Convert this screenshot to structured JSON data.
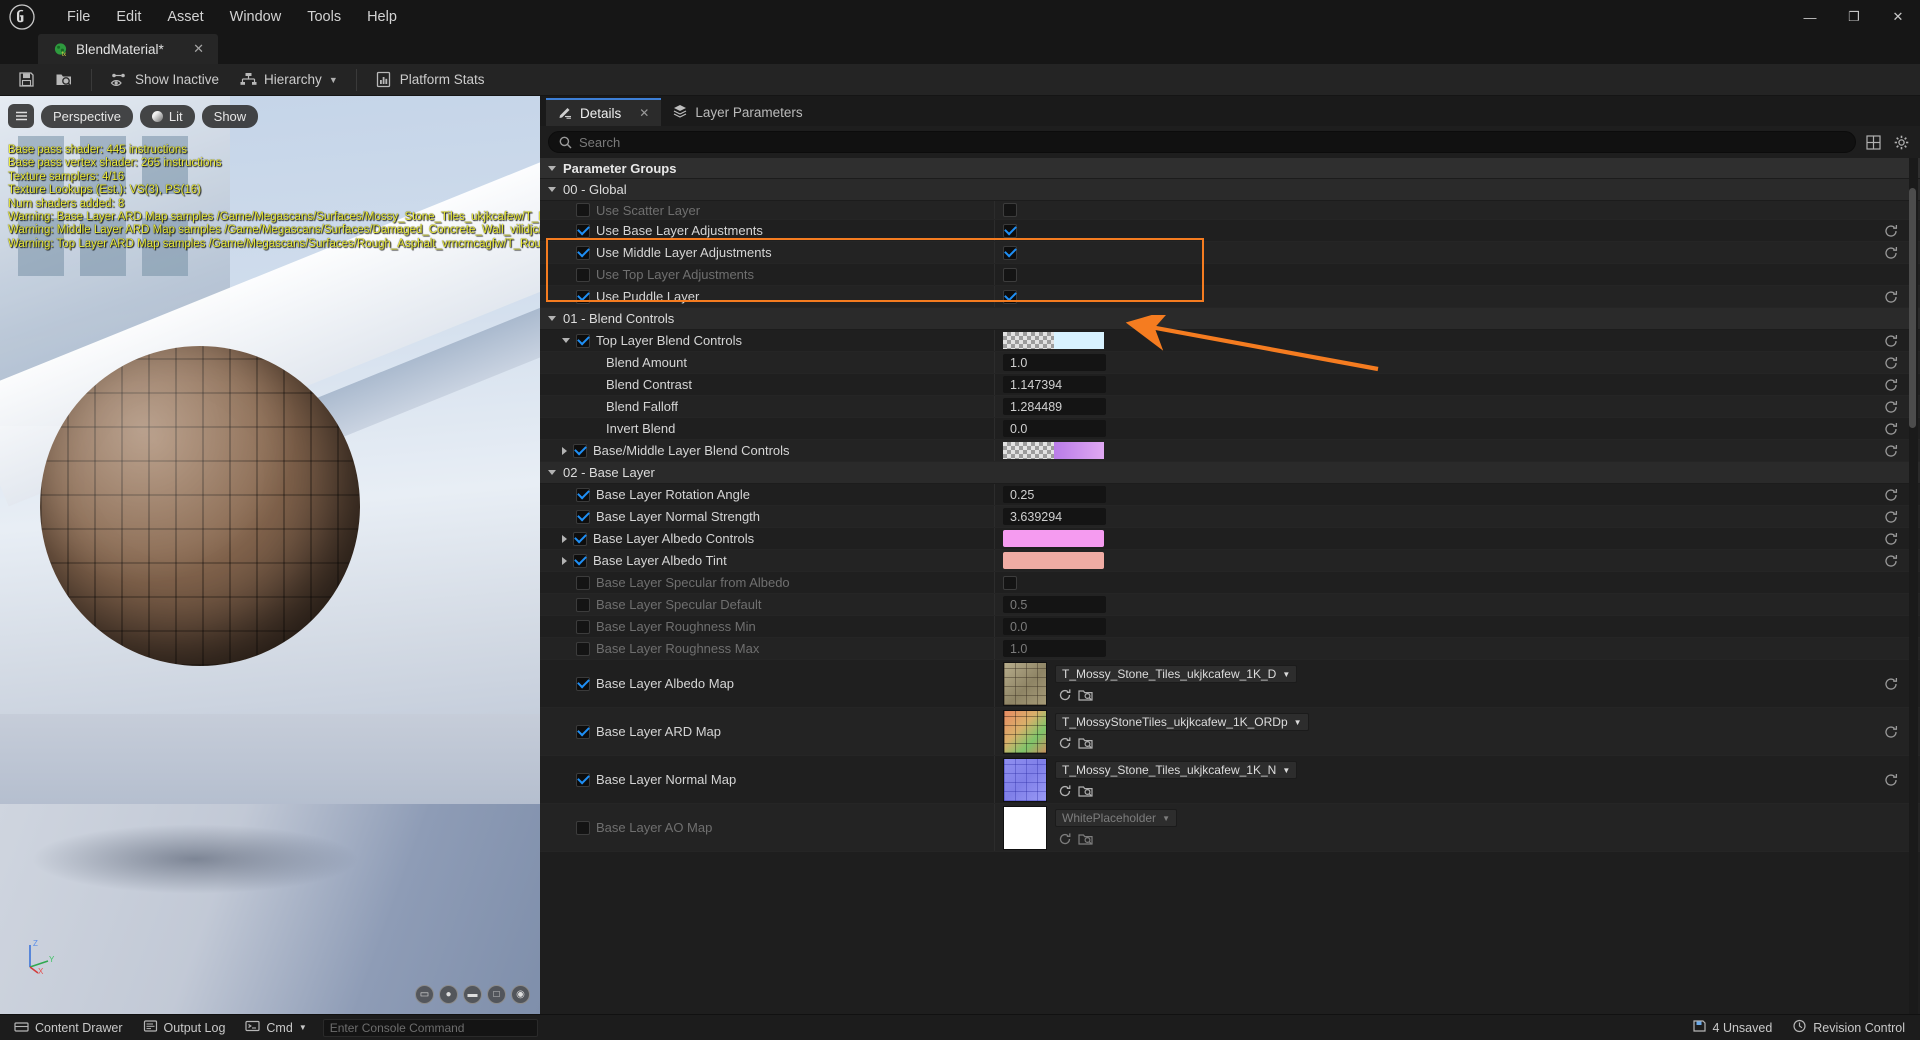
{
  "window": {
    "menus": [
      "File",
      "Edit",
      "Asset",
      "Window",
      "Tools",
      "Help"
    ],
    "controls": {
      "minimize": "—",
      "maximize": "❐",
      "close": "✕"
    }
  },
  "document_tab": {
    "label": "BlendMaterial*",
    "close": "✕",
    "icon": "material-instance-icon"
  },
  "toolbar": {
    "save_icon": "save-icon",
    "browse_icon": "browse-to-asset-icon",
    "show_inactive": "Show Inactive",
    "hierarchy": "Hierarchy",
    "platform_stats": "Platform Stats"
  },
  "viewport": {
    "menu_icon": "viewport-menu-icon",
    "perspective": "Perspective",
    "lit": "Lit",
    "show": "Show",
    "stats": [
      "Base pass shader: 445 instructions",
      "Base pass vertex shader: 265 instructions",
      "Texture samplers: 4/16",
      "Texture Lookups (Est.): VS(3), PS(16)",
      "Num shaders added: 8",
      "Warning: Base Layer ARD Map samples /Game/Megascans/Surfaces/Mossy_Stone_Tiles_ukjkcafew/T_M",
      "Warning: Middle Layer ARD Map samples /Game/Megascans/Surfaces/Damaged_Concrete_Wall_vilidjc/T_",
      "Warning: Top Layer ARD Map samples /Game/Megascans/Surfaces/Rough_Asphalt_vrncmcagfw/T_Roug"
    ],
    "axis": {
      "z": "Z",
      "y": "Y",
      "x": "X"
    }
  },
  "panel_tabs": [
    {
      "label": "Details",
      "icon": "details-pencil-icon",
      "active": true,
      "close": "✕"
    },
    {
      "label": "Layer Parameters",
      "icon": "layers-icon",
      "active": false
    }
  ],
  "search": {
    "placeholder": "Search",
    "icon": "search-icon",
    "grid_icon": "grid-view-icon",
    "settings_icon": "gear-icon"
  },
  "sections": [
    {
      "type": "category",
      "label": "Parameter Groups",
      "expanded": true
    },
    {
      "type": "group",
      "label": "00 - Global",
      "expanded": true,
      "rows": [
        {
          "label": "Use Scatter Layer",
          "enabled_cb": false,
          "disabled": true,
          "value_type": "checkbox",
          "value_on": false,
          "reset": false,
          "clipped": true
        },
        {
          "label": "Use Base Layer Adjustments",
          "enabled_cb": true,
          "disabled": false,
          "value_type": "checkbox",
          "value_on": true,
          "reset": true
        },
        {
          "label": "Use Middle Layer Adjustments",
          "enabled_cb": true,
          "disabled": false,
          "value_type": "checkbox",
          "value_on": true,
          "reset": true
        },
        {
          "label": "Use Top Layer Adjustments",
          "enabled_cb": false,
          "disabled": true,
          "value_type": "checkbox",
          "value_on": false,
          "reset": false
        },
        {
          "label": "Use Puddle Layer",
          "enabled_cb": true,
          "disabled": false,
          "value_type": "checkbox",
          "value_on": true,
          "reset": true
        }
      ]
    },
    {
      "type": "group",
      "label": "01 - Blend Controls",
      "expanded": true,
      "rows": [
        {
          "label": "Top Layer Blend Controls",
          "enabled_cb": true,
          "expander": "down",
          "indent": 1,
          "value_type": "swatch_split",
          "colors": [
            "checker",
            "#d8f2ff"
          ],
          "reset": true
        },
        {
          "label": "Blend Amount",
          "indent": 3,
          "value_type": "number",
          "value": "1.0",
          "reset": true
        },
        {
          "label": "Blend Contrast",
          "indent": 3,
          "value_type": "number",
          "value": "1.147394",
          "reset": true
        },
        {
          "label": "Blend Falloff",
          "indent": 3,
          "value_type": "number",
          "value": "1.284489",
          "reset": true
        },
        {
          "label": "Invert Blend",
          "indent": 3,
          "value_type": "number",
          "value": "0.0",
          "reset": true
        },
        {
          "label": "Base/Middle Layer Blend Controls",
          "enabled_cb": true,
          "expander": "right",
          "indent": 1,
          "value_type": "swatch_split",
          "colors": [
            "checker",
            "#c77fe8"
          ],
          "reset": true
        }
      ]
    },
    {
      "type": "group",
      "label": "02 - Base Layer",
      "expanded": true,
      "rows": [
        {
          "label": "Base Layer Rotation Angle",
          "enabled_cb": true,
          "indent": 1,
          "value_type": "number",
          "value": "0.25",
          "reset": true
        },
        {
          "label": "Base Layer Normal Strength",
          "enabled_cb": true,
          "indent": 1,
          "value_type": "number",
          "value": "3.639294",
          "reset": true
        },
        {
          "label": "Base Layer Albedo Controls",
          "enabled_cb": true,
          "expander": "right",
          "indent": 1,
          "value_type": "swatch",
          "color": "#f59bf0",
          "reset": true
        },
        {
          "label": "Base Layer Albedo Tint",
          "enabled_cb": true,
          "expander": "right",
          "indent": 1,
          "value_type": "swatch",
          "color": "#f0aca4",
          "reset": true
        },
        {
          "label": "Base Layer Specular from Albedo",
          "enabled_cb": false,
          "disabled": true,
          "indent": 1,
          "value_type": "checkbox",
          "value_on": false,
          "reset": false
        },
        {
          "label": "Base Layer Specular Default",
          "enabled_cb": false,
          "disabled": true,
          "indent": 1,
          "value_type": "number",
          "value": "0.5",
          "dim": true,
          "reset": false
        },
        {
          "label": "Base Layer Roughness Min",
          "enabled_cb": false,
          "disabled": true,
          "indent": 1,
          "value_type": "number",
          "value": "0.0",
          "dim": true,
          "reset": false
        },
        {
          "label": "Base Layer Roughness Max",
          "enabled_cb": false,
          "disabled": true,
          "indent": 1,
          "value_type": "number",
          "value": "1.0",
          "dim": true,
          "reset": false
        },
        {
          "label": "Base Layer Albedo Map",
          "enabled_cb": true,
          "indent": 1,
          "value_type": "texture",
          "texture_name": "T_Mossy_Stone_Tiles_ukjkcafew_1K_D",
          "thumb": "albedo-mossy-stone",
          "reset": true
        },
        {
          "label": "Base Layer ARD Map",
          "enabled_cb": true,
          "indent": 1,
          "value_type": "texture",
          "texture_name": "T_MossyStoneTiles_ukjkcafew_1K_ORDp",
          "thumb": "ard-mossy-stone",
          "reset": true
        },
        {
          "label": "Base Layer Normal Map",
          "enabled_cb": true,
          "indent": 1,
          "value_type": "texture",
          "texture_name": "T_Mossy_Stone_Tiles_ukjkcafew_1K_N",
          "thumb": "normal-mossy-stone",
          "reset": true
        },
        {
          "label": "Base Layer AO Map",
          "enabled_cb": false,
          "disabled": true,
          "indent": 1,
          "value_type": "texture",
          "texture_name": "WhitePlaceholder",
          "thumb": "white-placeholder",
          "dim": true,
          "reset": false
        }
      ]
    }
  ],
  "annotations": {
    "highlight_color": "#f57c20",
    "box_label": "adjustment-rows-highlight",
    "arrow_label": "use-puddle-layer-arrow"
  },
  "statusbar": {
    "content_drawer": "Content Drawer",
    "output_log": "Output Log",
    "cmd": "Cmd",
    "console_placeholder": "Enter Console Command",
    "unsaved": "4 Unsaved",
    "revision": "Revision Control"
  }
}
